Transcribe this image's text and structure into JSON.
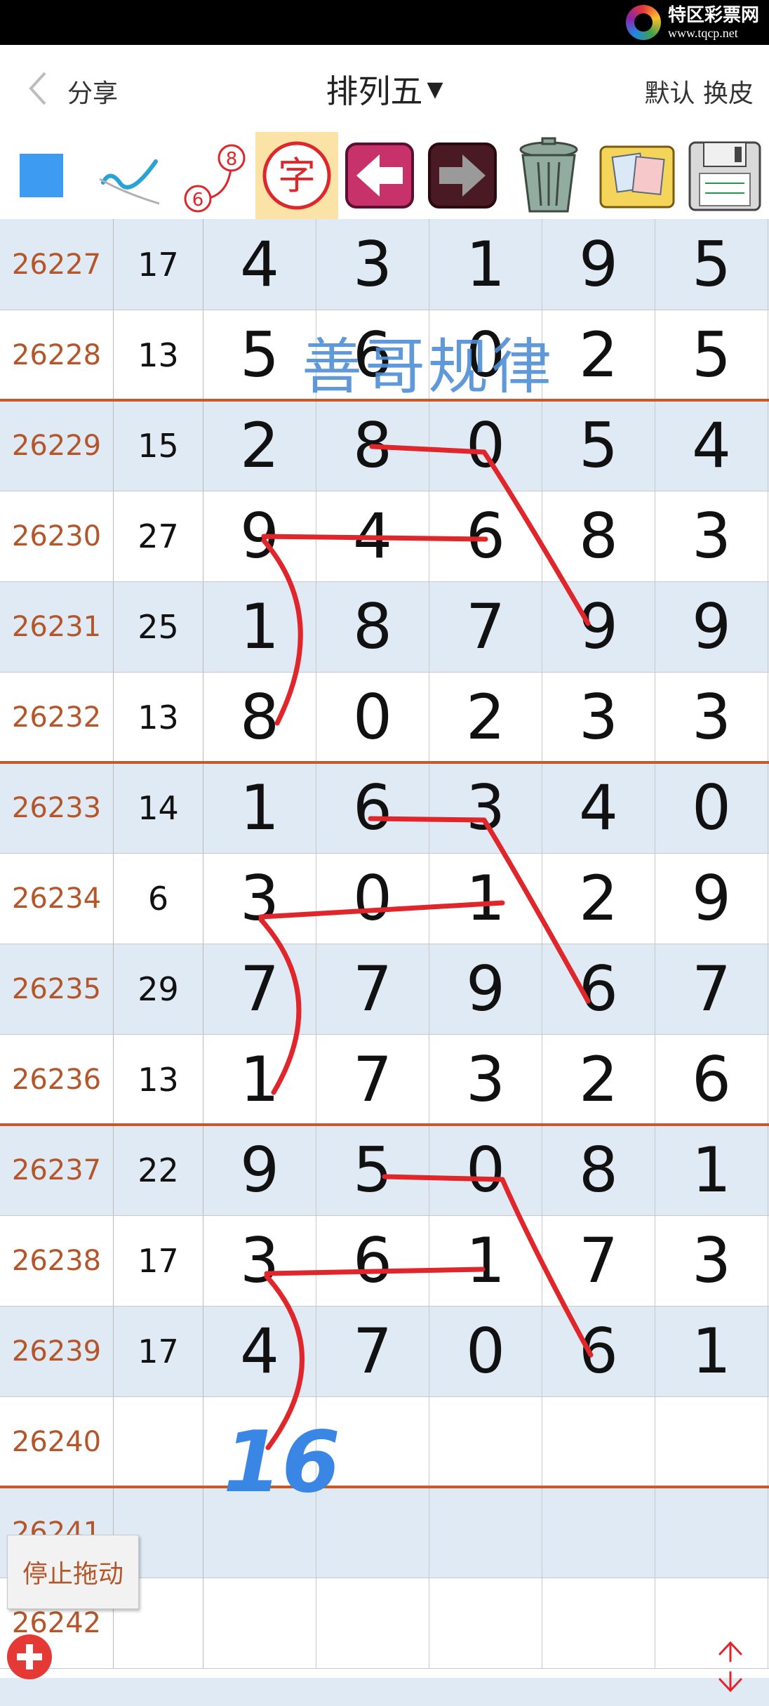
{
  "status": {
    "logo_text": "特区彩票网",
    "logo_url": "www.tqcp.net"
  },
  "header": {
    "back_label": "分享",
    "title": "排列五",
    "right_label": "默认 换皮"
  },
  "toolbar": {
    "tools": [
      {
        "name": "color-square-icon"
      },
      {
        "name": "pen-check-icon"
      },
      {
        "name": "sequence-icon",
        "label_top": "8",
        "label_bottom": "6"
      },
      {
        "name": "text-tool-icon",
        "label": "字"
      },
      {
        "name": "undo-arrow-icon"
      },
      {
        "name": "redo-arrow-icon"
      },
      {
        "name": "trash-icon"
      },
      {
        "name": "image-gallery-icon"
      },
      {
        "name": "save-disk-icon"
      }
    ],
    "accent": "#f4a28c"
  },
  "rows": [
    {
      "issue": "26227",
      "sum": "17",
      "digits": [
        "4",
        "3",
        "1",
        "9",
        "5"
      ]
    },
    {
      "issue": "26228",
      "sum": "13",
      "digits": [
        "5",
        "6",
        "0",
        "2",
        "5"
      ]
    },
    {
      "issue": "26229",
      "sum": "15",
      "digits": [
        "2",
        "8",
        "0",
        "5",
        "4"
      ]
    },
    {
      "issue": "26230",
      "sum": "27",
      "digits": [
        "9",
        "4",
        "6",
        "8",
        "3"
      ]
    },
    {
      "issue": "26231",
      "sum": "25",
      "digits": [
        "1",
        "8",
        "7",
        "9",
        "9"
      ]
    },
    {
      "issue": "26232",
      "sum": "13",
      "digits": [
        "8",
        "0",
        "2",
        "3",
        "3"
      ]
    },
    {
      "issue": "26233",
      "sum": "14",
      "digits": [
        "1",
        "6",
        "3",
        "4",
        "0"
      ]
    },
    {
      "issue": "26234",
      "sum": "6",
      "digits": [
        "3",
        "0",
        "1",
        "2",
        "9"
      ]
    },
    {
      "issue": "26235",
      "sum": "29",
      "digits": [
        "7",
        "7",
        "9",
        "6",
        "7"
      ]
    },
    {
      "issue": "26236",
      "sum": "13",
      "digits": [
        "1",
        "7",
        "3",
        "2",
        "6"
      ]
    },
    {
      "issue": "26237",
      "sum": "22",
      "digits": [
        "9",
        "5",
        "0",
        "8",
        "1"
      ]
    },
    {
      "issue": "26238",
      "sum": "17",
      "digits": [
        "3",
        "6",
        "1",
        "7",
        "3"
      ]
    },
    {
      "issue": "26239",
      "sum": "17",
      "digits": [
        "4",
        "7",
        "0",
        "6",
        "1"
      ]
    },
    {
      "issue": "26240",
      "sum": "",
      "digits": [
        "",
        "",
        "",
        "",
        ""
      ]
    },
    {
      "issue": "26241",
      "sum": "",
      "digits": [
        "",
        "",
        "",
        "",
        ""
      ]
    },
    {
      "issue": "26242",
      "sum": "",
      "digits": [
        "",
        "",
        "",
        "",
        ""
      ]
    }
  ],
  "annotations": {
    "watermark": "善哥规律",
    "handwritten_note": "16"
  },
  "controls": {
    "stop_drag_label": "停止拖动"
  },
  "colors": {
    "issue_text": "#b5562a",
    "row_shade": "#dfeaf5",
    "group_divider": "#c85a2a",
    "pen_red": "#e0262a",
    "note_blue": "#3a86e4"
  }
}
